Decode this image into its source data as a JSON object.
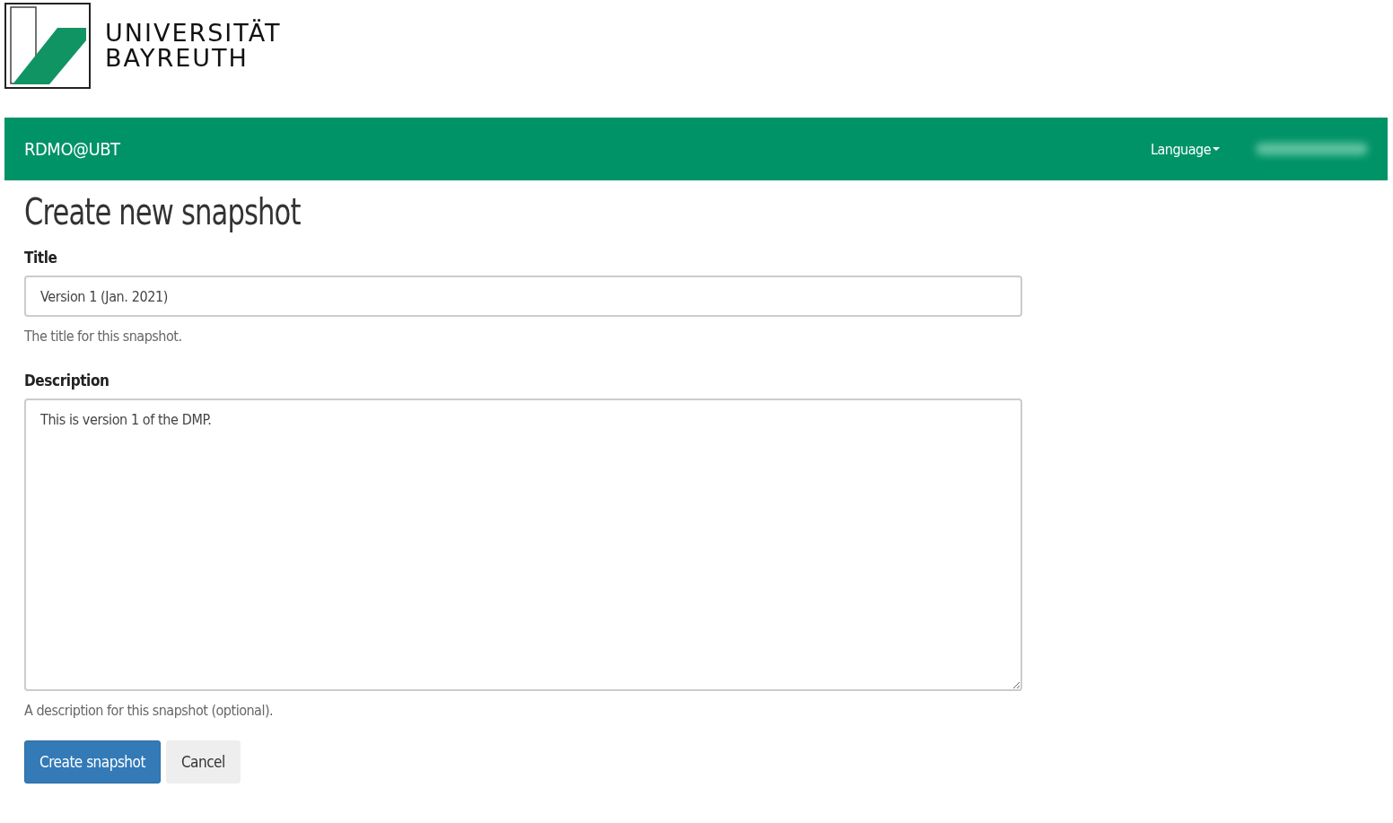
{
  "logo": {
    "line_1": "UNIVERSITÄT",
    "line_2": "BAYREUTH"
  },
  "navbar": {
    "brand": "RDMO@UBT",
    "menu": [
      {
        "label": "Language",
        "kind": "dropdown"
      },
      {
        "kind": "redacted"
      }
    ]
  },
  "heading": "Create new snapshot",
  "fields": [
    {
      "kind": "input",
      "label": "Title",
      "value": "Version 1 (Jan. 2021)",
      "help": "The title for this snapshot."
    },
    {
      "kind": "textarea",
      "label": "Description",
      "value": "This is version 1 of the DMP.",
      "help": "A description for this snapshot (optional)."
    }
  ],
  "buttons": [
    {
      "label": "Create snapshot",
      "kind": "primary"
    },
    {
      "label": "Cancel",
      "kind": "default"
    }
  ]
}
